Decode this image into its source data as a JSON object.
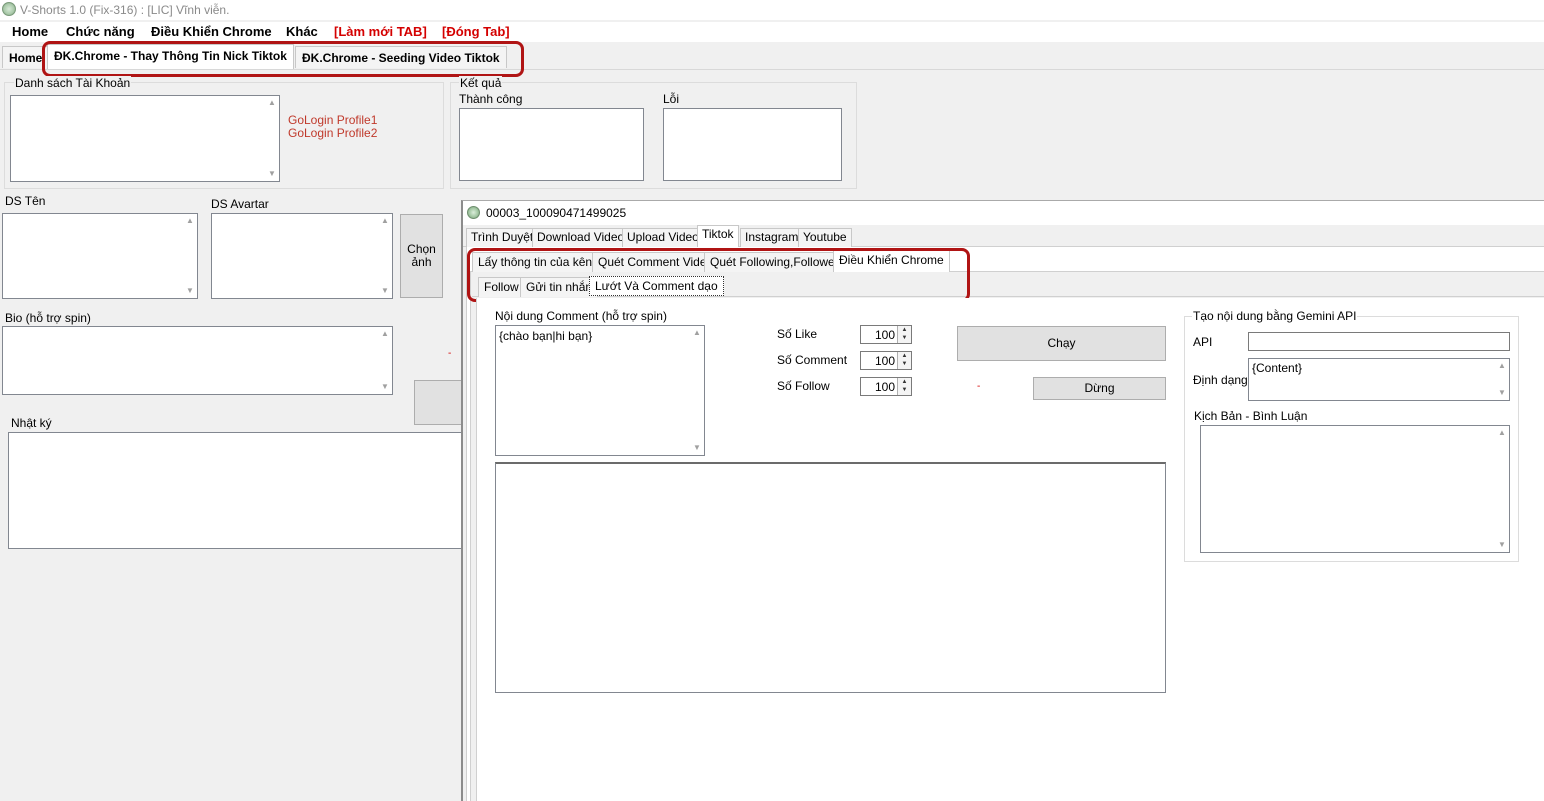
{
  "window": {
    "title": "V-Shorts 1.0 (Fix-316) : [LIC] Vĩnh viễn."
  },
  "menu": {
    "home": "Home",
    "features": "Chức năng",
    "chrome_control": "Điều Khiển Chrome",
    "other": "Khác",
    "refresh_tab": "[Làm mới TAB]",
    "close_tab": "[Đóng Tab]"
  },
  "main_tabs": {
    "home": "Home",
    "change_info": "ĐK.Chrome - Thay Thông Tin Nick Tiktok",
    "seeding": "ĐK.Chrome - Seeding Video Tiktok"
  },
  "left": {
    "account_list_label": "Danh sách Tài Khoản",
    "profiles": [
      "GoLogin Profile1",
      "GoLogin Profile2"
    ],
    "result_label": "Kết quả",
    "success_label": "Thành công",
    "error_label": "Lỗi",
    "names_label": "DS Tên",
    "avatar_label": "DS Avartar",
    "choose_image_btn": "Chọn ảnh",
    "bio_label": "Bio (hỗ trợ spin)",
    "dash": "-",
    "log_label": "Nhật ký"
  },
  "child": {
    "title": "00003_100090471499025",
    "tabs": [
      "Trình Duyệt",
      "Download Video",
      "Upload Video",
      "Tiktok",
      "Instagram",
      "Youtube"
    ],
    "subtabs": [
      "Lấy thông tin của kênh",
      "Quét Comment Video",
      "Quét Following,Followers",
      "Điều Khiển Chrome"
    ],
    "subsubtabs": [
      "Follow",
      "Gửi tin nhắn",
      "Lướt Và Comment dạo"
    ],
    "comment_label": "Nội dung Comment (hỗ trợ spin)",
    "comment_value": "{chào bạn|hi bạn}",
    "like_label": "Số Like",
    "like_value": "100",
    "comment_count_label": "Số Comment",
    "comment_count_value": "100",
    "follow_label": "Số Follow",
    "follow_value": "100",
    "run_btn": "Chạy",
    "stop_btn": "Dừng",
    "dash": "-",
    "gemini_group": "Tạo nội dung bằng Gemini API",
    "api_label": "API",
    "api_value": "",
    "format_label": "Định dạng",
    "format_value": "{Content}",
    "script_label": "Kịch Bản - Bình Luận"
  },
  "colors": {
    "highlight": "#b01414",
    "menu_red": "#d40000",
    "profile_red": "#c0392b"
  }
}
